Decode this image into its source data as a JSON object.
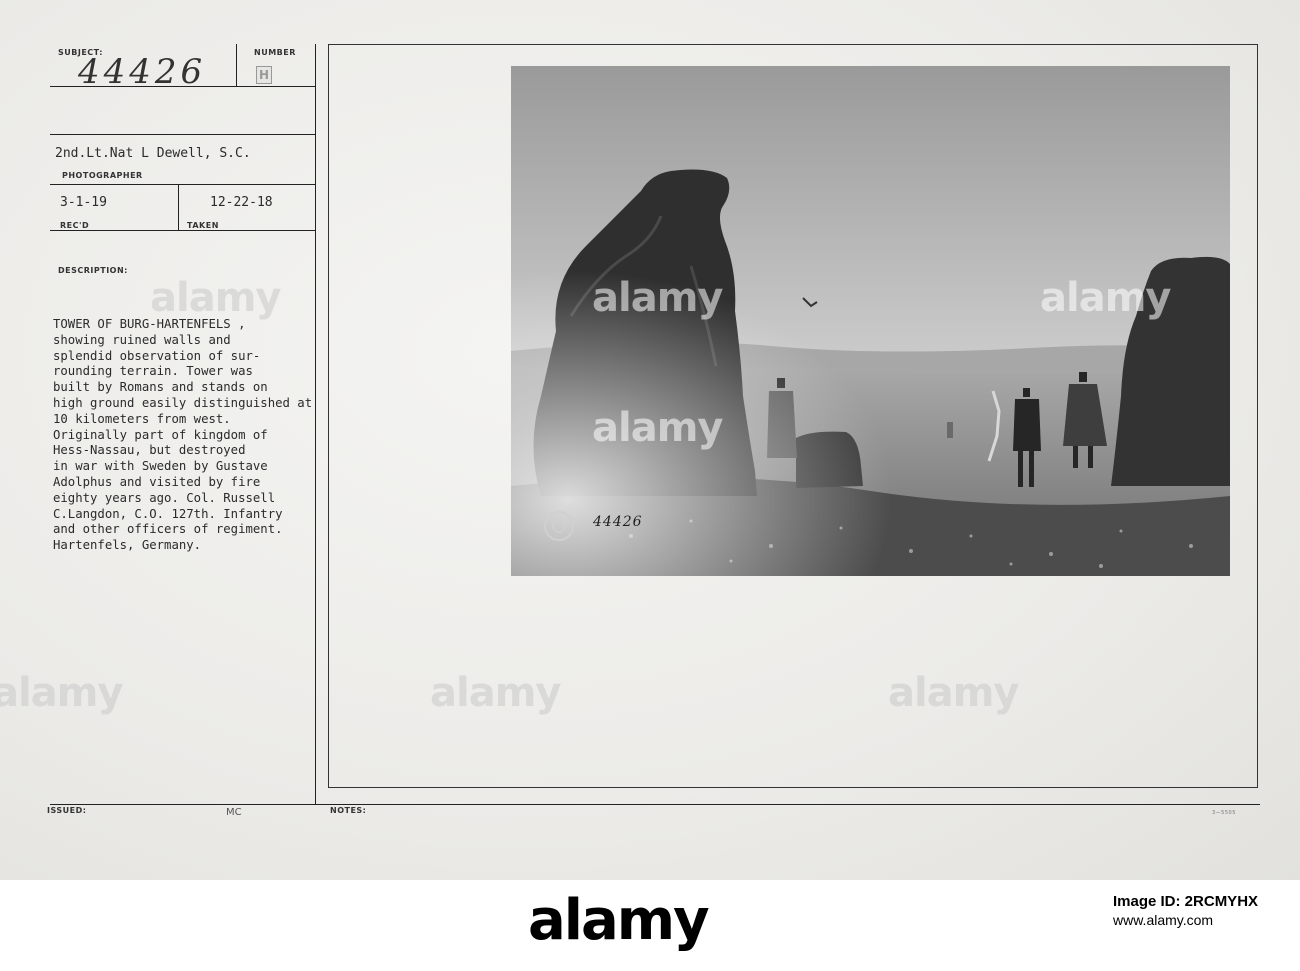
{
  "record": {
    "subject_label": "SUBJECT:",
    "subject_value": "44426",
    "number_label": "NUMBER",
    "number_value": "H",
    "photographer_value": "2nd.Lt.Nat L Dewell, S.C.",
    "photographer_label": "PHOTOGRAPHER",
    "recd_value": "3-1-19",
    "recd_label": "REC'D",
    "taken_value": "12-22-18",
    "taken_label": "TAKEN",
    "description_label": "DESCRIPTION:",
    "description_lines": [
      "TOWER OF BURG-HARTENFELS ,",
      "showing ruined walls and",
      "splendid observation of sur-",
      "rounding terrain. Tower was",
      "built by Romans and stands on",
      "high ground easily distinguished at",
      "10 kilometers from west.",
      "Originally part of kingdom of",
      "Hess-Nassau, but destroyed",
      "in war with Sweden by Gustave",
      "Adolphus and visited by fire",
      "eighty years ago. Col. Russell",
      "C.Langdon, C.O. 127th. Infantry",
      "and other officers of regiment.",
      "Hartenfels, Germany."
    ],
    "issued_label": "ISSUED:",
    "issued_value": "MC",
    "notes_label": "NOTES:",
    "form_code": "3—5505"
  },
  "photo": {
    "handwritten_number": "44426"
  },
  "watermark": {
    "text": "alamy"
  },
  "footer": {
    "logo_text": "alamy",
    "image_id_label": "Image ID: 2RCMYHX",
    "site_text": "www.alamy.com"
  }
}
